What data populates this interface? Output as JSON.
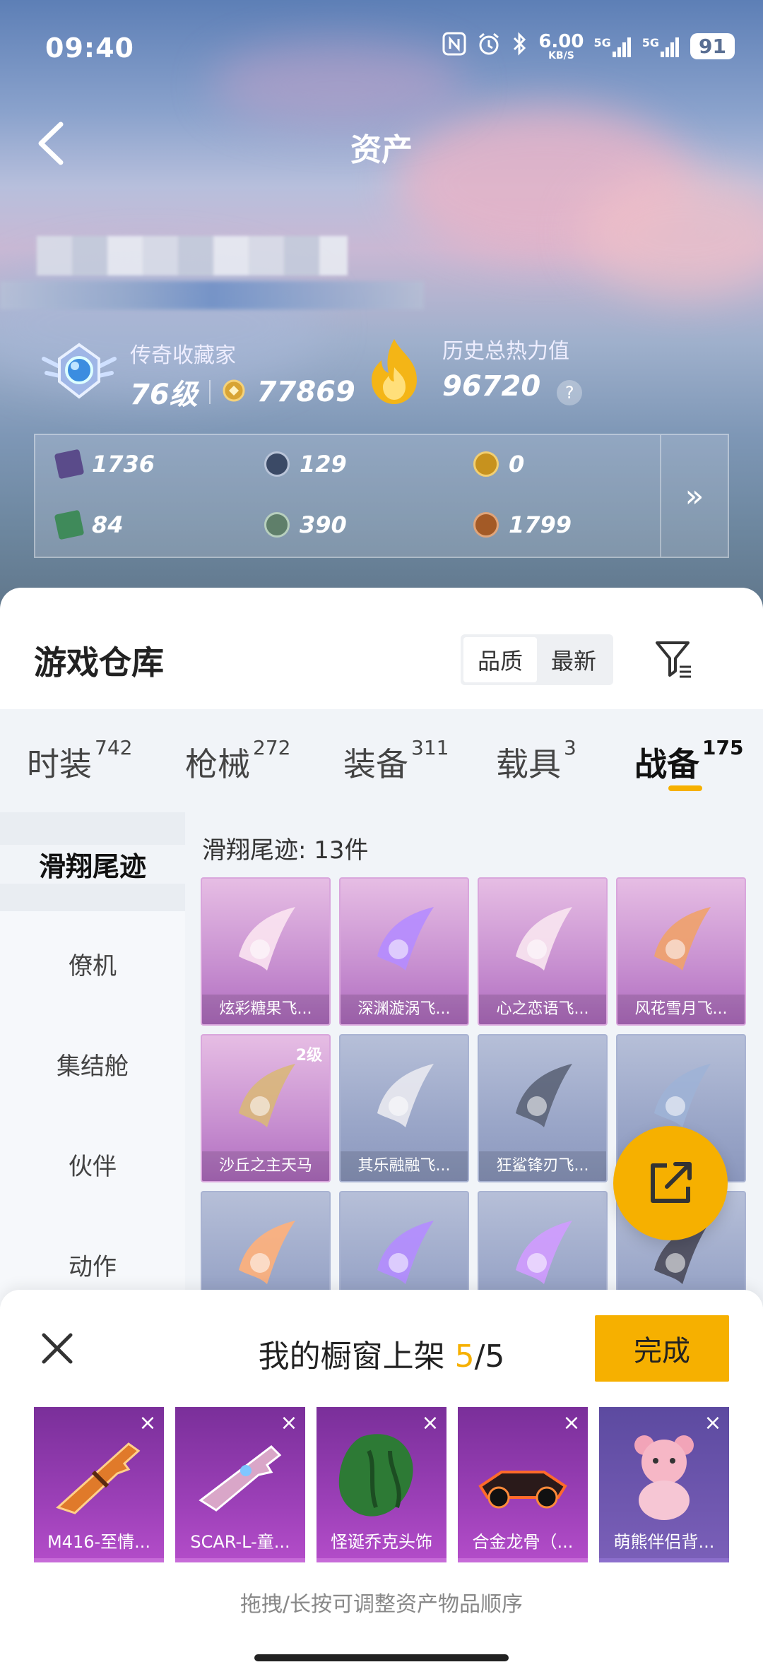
{
  "status_bar": {
    "time": "09:40",
    "speed": "6.00",
    "speed_unit": "KB/S",
    "net1": "5G",
    "net2": "5G",
    "battery": "91"
  },
  "header": {
    "title": "资产"
  },
  "profile": {
    "collector_label": "传奇收藏家",
    "level": "76级",
    "points": "77869",
    "heat_label": "历史总热力值",
    "heat_value": "96720",
    "help": "?"
  },
  "resources": [
    {
      "value": "1736",
      "color": "#5a4b8a"
    },
    {
      "value": "129",
      "color": "#3b4a66"
    },
    {
      "value": "0",
      "color": "#c7921e"
    },
    {
      "value": "84",
      "color": "#3f8a5a"
    },
    {
      "value": "390",
      "color": "#5f7f6a"
    },
    {
      "value": "1799",
      "color": "#a35a26"
    }
  ],
  "resources_more": "»",
  "warehouse": {
    "title": "游戏仓库",
    "sort_options": [
      "品质",
      "最新"
    ],
    "tabs": [
      {
        "label": "时装",
        "count": "742"
      },
      {
        "label": "枪械",
        "count": "272"
      },
      {
        "label": "装备",
        "count": "311"
      },
      {
        "label": "载具",
        "count": "3"
      },
      {
        "label": "战备",
        "count": "175"
      }
    ],
    "side_items": [
      "滑翔尾迹",
      "僚机",
      "集结舱",
      "伙伴",
      "动作"
    ],
    "count_text": "滑翔尾迹: 13件",
    "cards": [
      {
        "name": "炫彩糖果飞...",
        "tone": "pink"
      },
      {
        "name": "深渊漩涡飞...",
        "tone": "pink"
      },
      {
        "name": "心之恋语飞...",
        "tone": "pink"
      },
      {
        "name": "风花雪月飞...",
        "tone": "pink"
      },
      {
        "name": "沙丘之主天马",
        "tone": "pink",
        "level": "2级"
      },
      {
        "name": "其乐融融飞...",
        "tone": "blue"
      },
      {
        "name": "狂鲨锋刃飞...",
        "tone": "blue"
      },
      {
        "name": "",
        "tone": "blue"
      },
      {
        "name": "",
        "tone": "blue"
      },
      {
        "name": "",
        "tone": "blue"
      },
      {
        "name": "",
        "tone": "blue"
      },
      {
        "name": "",
        "tone": "blue"
      }
    ]
  },
  "showcase": {
    "title_prefix": "我的橱窗上架",
    "current": "5",
    "sep_total": "/5",
    "done": "完成",
    "items": [
      {
        "name": "M416-至情..."
      },
      {
        "name": "SCAR-L-童..."
      },
      {
        "name": "怪诞乔克头饰"
      },
      {
        "name": "合金龙骨（..."
      },
      {
        "name": "萌熊伴侣背..."
      }
    ],
    "remove": "×",
    "hint": "拖拽/长按可调整资产物品顺序"
  }
}
